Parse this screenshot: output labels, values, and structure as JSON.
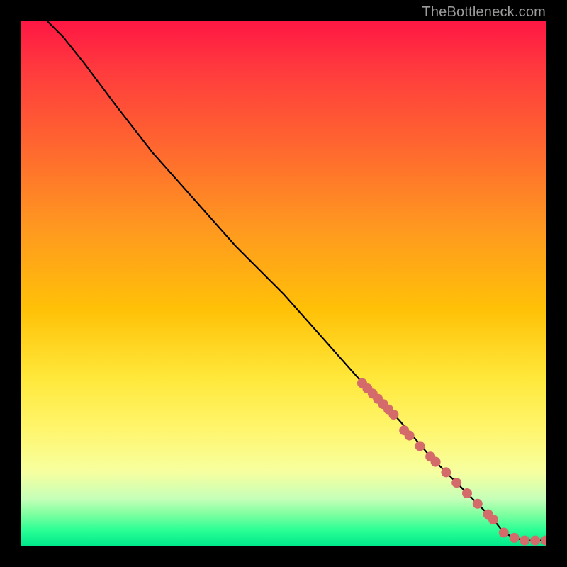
{
  "watermark": "TheBottleneck.com",
  "colors": {
    "dot": "#d46a6a",
    "line": "#000000"
  },
  "chart_data": {
    "type": "line",
    "title": "",
    "xlabel": "",
    "ylabel": "",
    "xlim": [
      0,
      100
    ],
    "ylim": [
      0,
      100
    ],
    "grid": false,
    "legend": false,
    "note": "Values estimated from pixel positions; x = horizontal 0–100 left→right, y = vertical 0–100 bottom→top. Curve is a decreasing line reaching near 0 and flattening near x≈92.",
    "series": [
      {
        "name": "curve",
        "x": [
          5,
          8,
          12,
          18,
          25,
          33,
          41,
          50,
          58,
          66,
          72,
          78,
          83,
          87,
          90,
          92,
          94,
          96,
          98,
          100
        ],
        "y": [
          100,
          97,
          92,
          84,
          75,
          66,
          57,
          48,
          39,
          30,
          24,
          17,
          12,
          8,
          5,
          2.5,
          1.5,
          1,
          1,
          1
        ]
      }
    ],
    "markers": {
      "name": "highlighted-dots",
      "x": [
        65,
        66,
        67,
        68,
        69,
        70,
        71,
        73,
        74,
        76,
        78,
        79,
        81,
        83,
        85,
        87,
        89,
        90,
        92,
        94,
        96,
        98,
        100
      ],
      "y": [
        31,
        30,
        29,
        28,
        27,
        26,
        25,
        22,
        21,
        19,
        17,
        16,
        14,
        12,
        10,
        8,
        6,
        5,
        2.5,
        1.5,
        1,
        1,
        1
      ]
    }
  }
}
